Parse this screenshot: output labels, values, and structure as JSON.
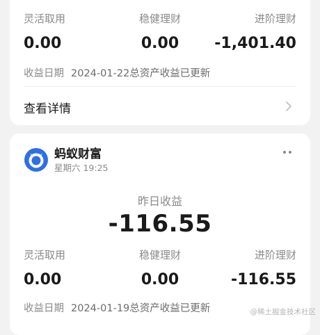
{
  "card1": {
    "labels": {
      "flexible": "灵活取用",
      "stable": "稳健理财",
      "advanced": "进阶理财"
    },
    "values": {
      "flexible": "0.00",
      "stable": "0.00",
      "advanced": "-1,401.40"
    },
    "date_label": "收益日期",
    "date_value": "2024-01-22总资产收益已更新",
    "details_label": "查看详情"
  },
  "card2": {
    "app_name": "蚂蚁财富",
    "time": "星期六 19:25",
    "center_label": "昨日收益",
    "center_value": "-116.55",
    "labels": {
      "flexible": "灵活取用",
      "stable": "稳健理财",
      "advanced": "进阶理财"
    },
    "values": {
      "flexible": "0.00",
      "stable": "0.00",
      "advanced": "-116.55"
    },
    "date_label": "收益日期",
    "date_value": "2024-01-19总资产收益已更新"
  },
  "watermark": "@稀土掘金技术社区",
  "icons": {
    "chevron": "chevron-right-icon",
    "more": "more-dots-icon",
    "app": "ant-fortune-logo-icon"
  },
  "colors": {
    "logo_blue": "#2f6fe4",
    "background": "#f2f2f2",
    "card": "#ffffff"
  }
}
